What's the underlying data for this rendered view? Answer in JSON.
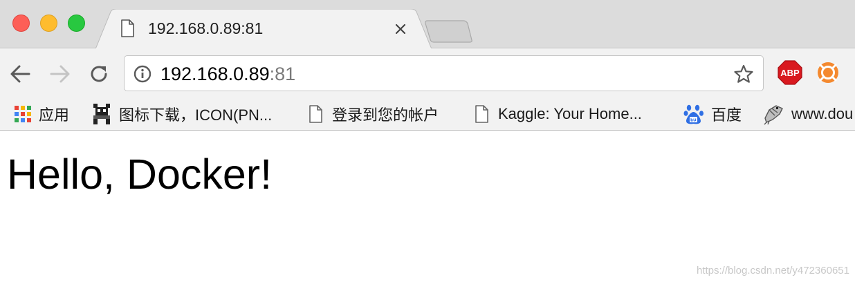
{
  "tab": {
    "title": "192.168.0.89:81"
  },
  "omnibox": {
    "url_host": "192.168.0.89",
    "url_port": ":81"
  },
  "extensions": {
    "abp_label": "ABP"
  },
  "bookmarks": [
    {
      "label": "应用",
      "icon": "apps-grid-icon"
    },
    {
      "label": "图标下载，ICON(PN...",
      "icon": "pixel-robot-icon"
    },
    {
      "label": "登录到您的帐户",
      "icon": "page-icon"
    },
    {
      "label": "Kaggle: Your Home...",
      "icon": "page-icon"
    },
    {
      "label": "百度",
      "icon": "baidu-paw-icon"
    },
    {
      "label": "www.dou",
      "icon": "pixel-bird-icon"
    }
  ],
  "page": {
    "heading": "Hello, Docker!",
    "watermark": "https://blog.csdn.net/y472360651"
  },
  "colors": {
    "tabstrip_bg": "#dcdcdc",
    "toolbar_bg": "#f2f2f2",
    "close_red": "#fd5f57",
    "minimize_yellow": "#febc2e",
    "maximize_green": "#28c840",
    "abp_red": "#d9191f",
    "ext_orange": "#f4892f"
  }
}
